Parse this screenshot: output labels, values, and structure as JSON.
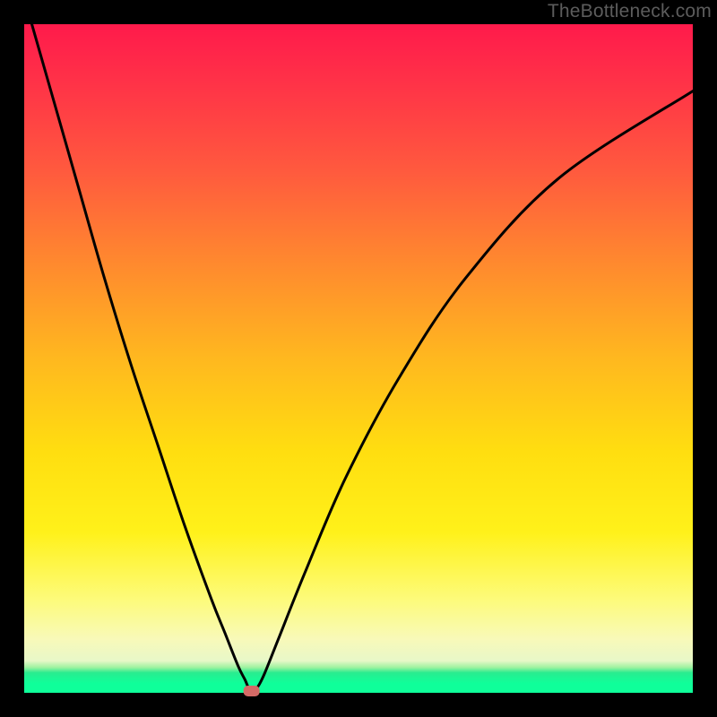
{
  "watermark": "TheBottleneck.com",
  "chart_data": {
    "type": "line",
    "title": "",
    "xlabel": "",
    "ylabel": "",
    "xlim": [
      0,
      100
    ],
    "ylim": [
      0,
      100
    ],
    "legend": false,
    "grid": false,
    "background": {
      "type": "vertical-gradient",
      "stops": [
        {
          "pos": 0,
          "color": "#ff1a4b"
        },
        {
          "pos": 50,
          "color": "#ffb81f"
        },
        {
          "pos": 76,
          "color": "#fff11a"
        },
        {
          "pos": 95,
          "color": "#e8f8c8"
        },
        {
          "pos": 100,
          "color": "#0fff9a"
        }
      ]
    },
    "series": [
      {
        "name": "bottleneck-curve",
        "color": "#000000",
        "x": [
          0,
          4,
          8,
          12,
          16,
          20,
          24,
          28,
          30,
          32,
          33,
          34,
          35,
          36,
          38,
          42,
          48,
          56,
          66,
          80,
          100
        ],
        "y": [
          104,
          90,
          76,
          62,
          49,
          37,
          25,
          14,
          9,
          4,
          2,
          0,
          1,
          3,
          8,
          18,
          32,
          47,
          62,
          77,
          90
        ]
      }
    ],
    "marker": {
      "name": "minimum-point",
      "x": 34,
      "y": 0,
      "color": "#d46a66",
      "shape": "rounded-rect"
    }
  }
}
